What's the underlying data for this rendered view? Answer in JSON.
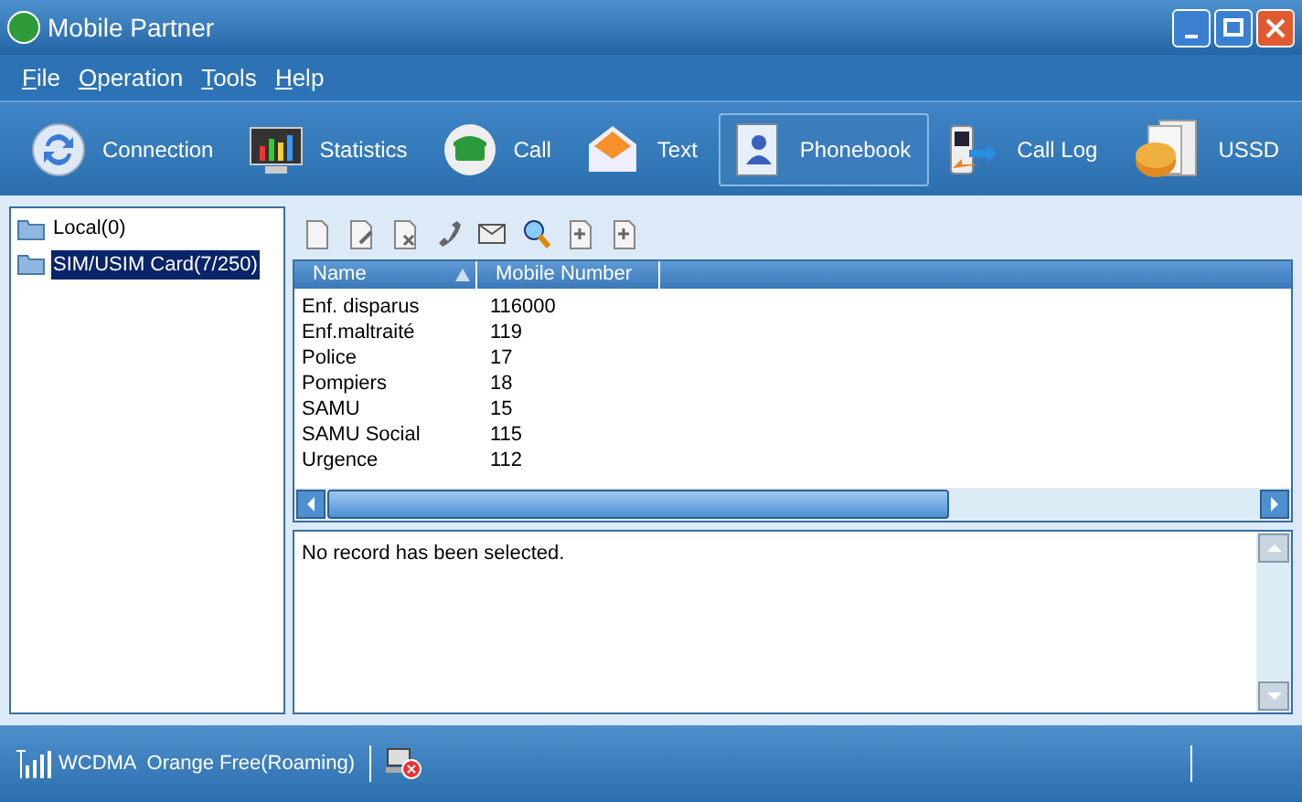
{
  "window": {
    "title": "Mobile Partner"
  },
  "menu": [
    "File",
    "Operation",
    "Tools",
    "Help"
  ],
  "toolbar": [
    {
      "label": "Connection",
      "selected": false
    },
    {
      "label": "Statistics",
      "selected": false
    },
    {
      "label": "Call",
      "selected": false
    },
    {
      "label": "Text",
      "selected": false
    },
    {
      "label": "Phonebook",
      "selected": true
    },
    {
      "label": "Call Log",
      "selected": false
    },
    {
      "label": "USSD",
      "selected": false
    }
  ],
  "tree": [
    {
      "label": "Local(0)",
      "selected": false
    },
    {
      "label": "SIM/USIM Card(7/250)",
      "selected": true
    }
  ],
  "table": {
    "columns": [
      "Name",
      "Mobile Number"
    ],
    "rows": [
      [
        "Enf. disparus",
        "116000"
      ],
      [
        "Enf.maltraité",
        "119"
      ],
      [
        "Police",
        "17"
      ],
      [
        "Pompiers",
        "18"
      ],
      [
        "SAMU",
        "15"
      ],
      [
        "SAMU Social",
        "115"
      ],
      [
        "Urgence",
        "112"
      ]
    ]
  },
  "detail": "No record has been selected.",
  "status_bar": {
    "network": "WCDMA  Orange Free(Roaming)"
  }
}
